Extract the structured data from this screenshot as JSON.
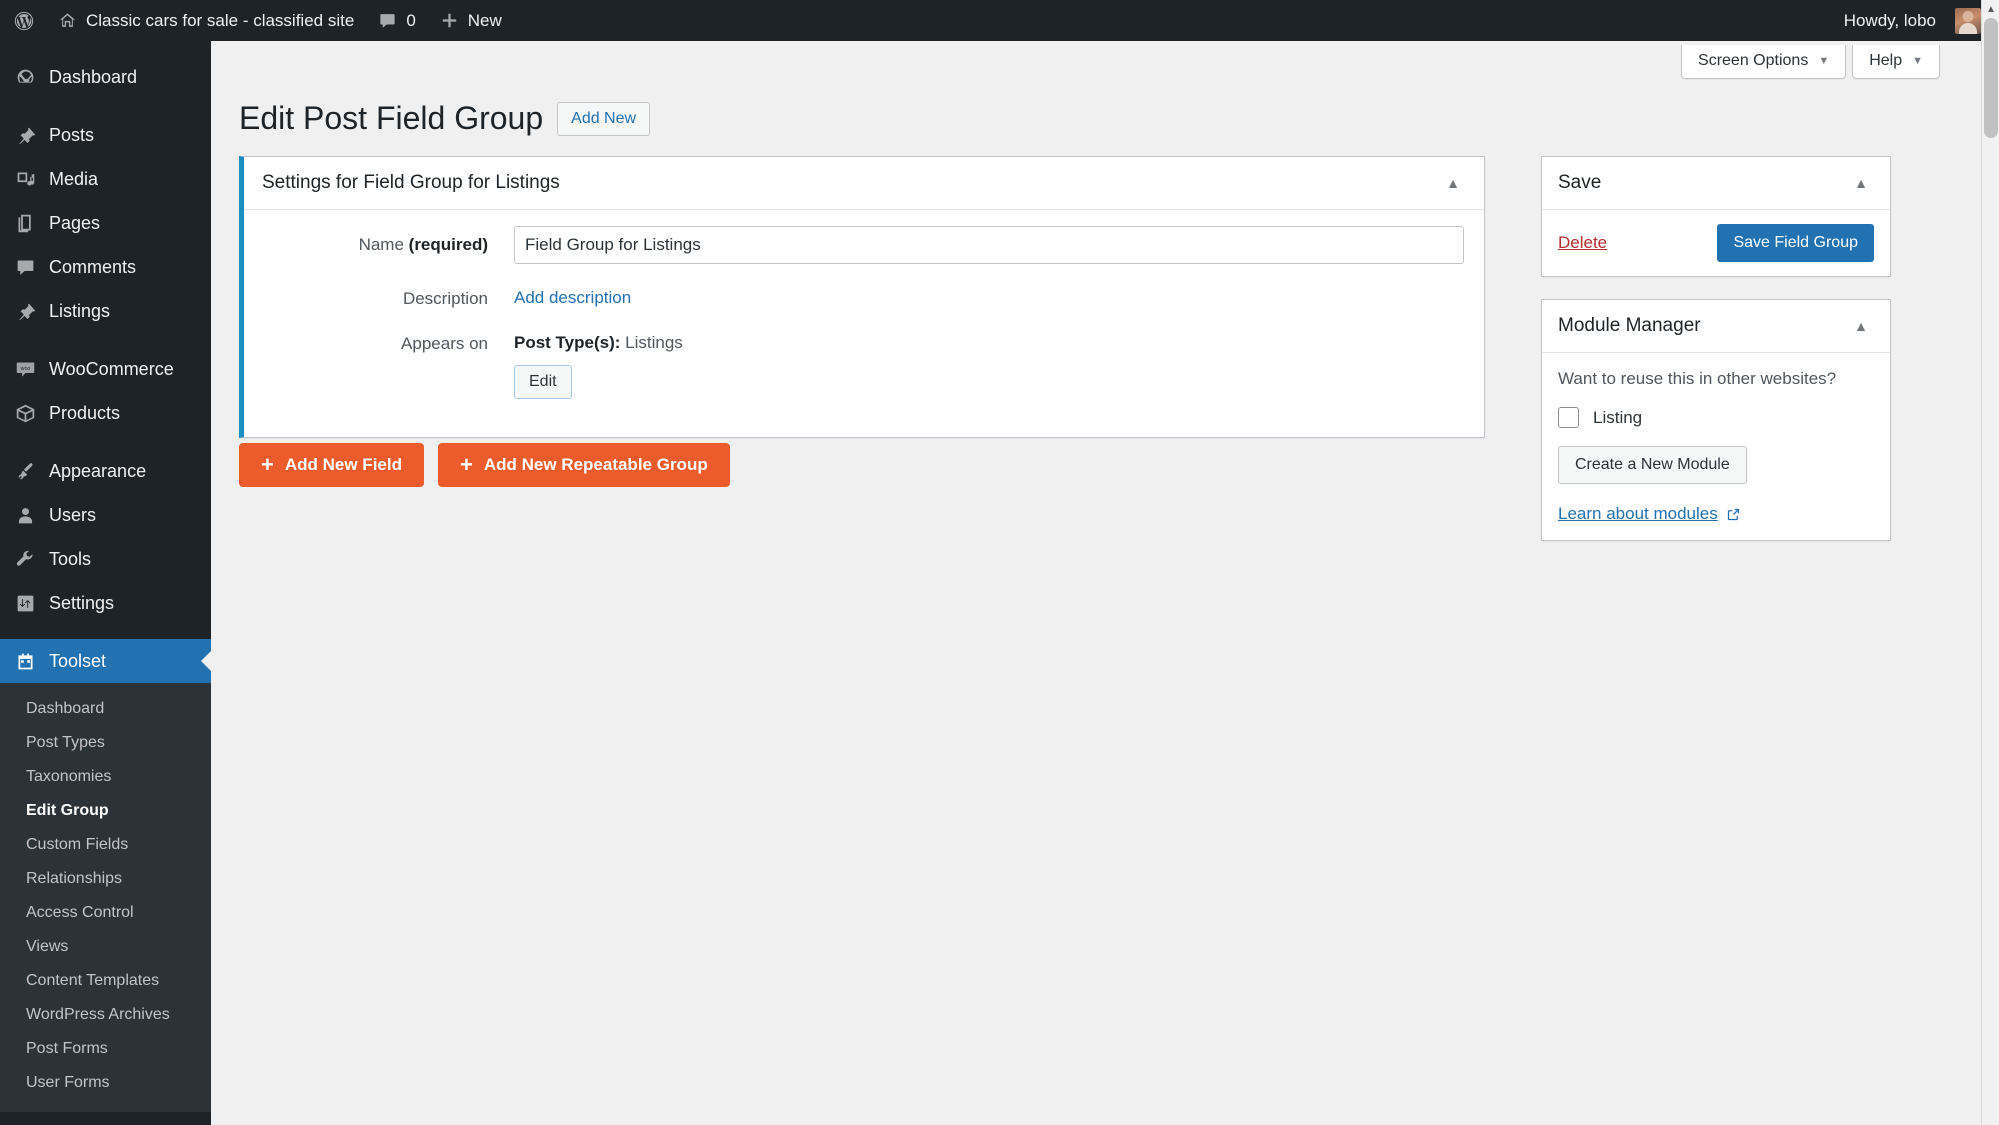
{
  "adminbar": {
    "wp_logo": "wordpress-logo-icon",
    "site_name": "Classic cars for sale - classified site",
    "comments_count": "0",
    "new_label": "New",
    "howdy": "Howdy, lobo"
  },
  "sidebar": {
    "items": [
      {
        "label": "Dashboard",
        "icon": "dashboard-icon"
      },
      {
        "label": "Posts",
        "icon": "pin-icon"
      },
      {
        "label": "Media",
        "icon": "media-icon"
      },
      {
        "label": "Pages",
        "icon": "pages-icon"
      },
      {
        "label": "Comments",
        "icon": "comment-icon"
      },
      {
        "label": "Listings",
        "icon": "pin-icon"
      },
      {
        "label": "WooCommerce",
        "icon": "woocommerce-icon"
      },
      {
        "label": "Products",
        "icon": "products-box-icon"
      },
      {
        "label": "Appearance",
        "icon": "paintbrush-icon"
      },
      {
        "label": "Users",
        "icon": "user-icon"
      },
      {
        "label": "Tools",
        "icon": "wrench-icon"
      },
      {
        "label": "Settings",
        "icon": "settings-sliders-icon"
      },
      {
        "label": "Toolset",
        "icon": "toolset-icon"
      }
    ],
    "submenu": [
      {
        "label": "Dashboard"
      },
      {
        "label": "Post Types"
      },
      {
        "label": "Taxonomies"
      },
      {
        "label": "Edit Group"
      },
      {
        "label": "Custom Fields"
      },
      {
        "label": "Relationships"
      },
      {
        "label": "Access Control"
      },
      {
        "label": "Views"
      },
      {
        "label": "Content Templates"
      },
      {
        "label": "WordPress Archives"
      },
      {
        "label": "Post Forms"
      },
      {
        "label": "User Forms"
      }
    ],
    "active_submenu": "Edit Group",
    "active_item": "Toolset"
  },
  "screen_meta": {
    "screen_options": "Screen Options",
    "help": "Help",
    "caret": "▼"
  },
  "page": {
    "title": "Edit Post Field Group",
    "add_new": "Add New"
  },
  "settings_box": {
    "title": "Settings for Field Group for Listings",
    "toggle": "▲",
    "name_label_prefix": "Name ",
    "name_label_required": "(required)",
    "name_value": "Field Group for Listings",
    "description_label": "Description",
    "description_link": "Add description",
    "appears_label": "Appears on",
    "appears_prefix": "Post Type(s):",
    "appears_value": "Listings",
    "edit_button": "Edit"
  },
  "actions": {
    "add_new_field": "Add New Field",
    "add_new_repeatable_group": "Add New Repeatable Group",
    "plus": "+"
  },
  "save_box": {
    "title": "Save",
    "toggle": "▲",
    "delete": "Delete",
    "save_button": "Save Field Group"
  },
  "module_manager": {
    "title": "Module Manager",
    "toggle": "▲",
    "question": "Want to reuse this in other websites?",
    "checkbox_label": "Listing",
    "checkbox_checked": false,
    "create_button": "Create a New Module",
    "learn_link": "Learn about modules",
    "external_icon": "external-link-icon"
  },
  "colors": {
    "admin_bar": "#1d2327",
    "sidebar": "#1d2327",
    "submenu": "#2c3338",
    "accent_blue": "#2271b1",
    "accent_teal": "#1d8ec1",
    "orange_button": "#ec5b2b",
    "delete_red": "#b32d2e",
    "page_bg": "#f0f0f1"
  }
}
